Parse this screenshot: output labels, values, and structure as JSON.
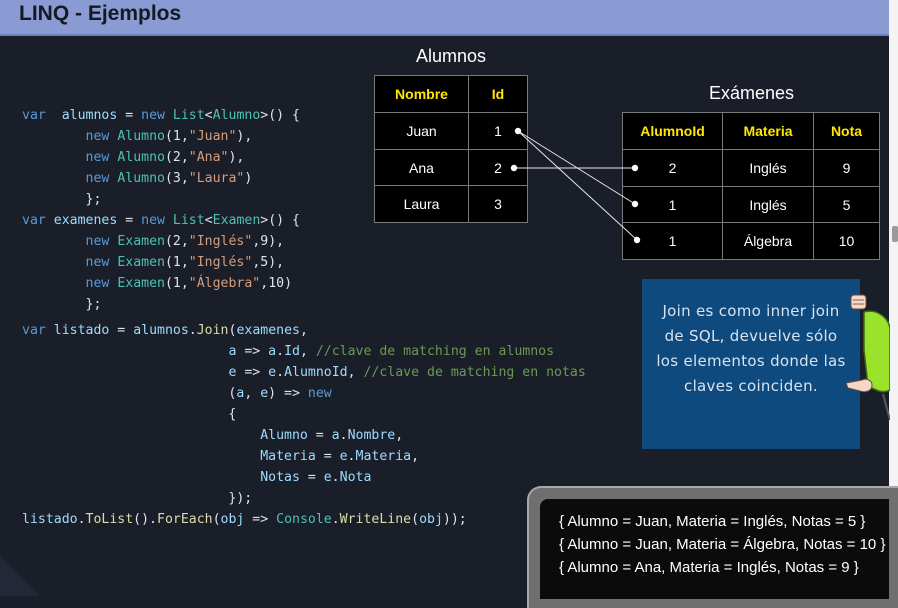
{
  "header": {
    "title": "LINQ - Ejemplos"
  },
  "alumnos_table": {
    "title": "Alumnos",
    "headers": [
      "Nombre",
      "Id"
    ],
    "rows": [
      [
        "Juan",
        "1"
      ],
      [
        "Ana",
        "2"
      ],
      [
        "Laura",
        "3"
      ]
    ]
  },
  "examenes_table": {
    "title": "Exámenes",
    "headers": [
      "AlumnoId",
      "Materia",
      "Nota"
    ],
    "rows": [
      [
        "2",
        "Inglés",
        "9"
      ],
      [
        "1",
        "Inglés",
        "5"
      ],
      [
        "1",
        "Álgebra",
        "10"
      ]
    ]
  },
  "note": {
    "text": "Join es como inner join de SQL, devuelve sólo los elementos donde las claves coinciden."
  },
  "console": {
    "lines": [
      "{ Alumno = Juan, Materia = Inglés, Notas = 5 }",
      "{ Alumno = Juan, Materia = Álgebra, Notas = 10 }",
      "{ Alumno = Ana, Materia = Inglés, Notas = 9 }"
    ]
  },
  "code": {
    "block1": [
      [
        [
          "kw",
          "var"
        ],
        [
          "",
          "  "
        ],
        [
          "vr",
          "alumnos"
        ],
        [
          "",
          " = "
        ],
        [
          "kw",
          "new"
        ],
        [
          "",
          " "
        ],
        [
          "ty",
          "List"
        ],
        [
          "",
          "<"
        ],
        [
          "ty",
          "Alumno"
        ],
        [
          "",
          ">() {"
        ]
      ],
      [
        [
          "",
          "        "
        ],
        [
          "kw",
          "new"
        ],
        [
          "",
          " "
        ],
        [
          "ty",
          "Alumno"
        ],
        [
          "",
          "(1,"
        ],
        [
          "st",
          "\"Juan\""
        ],
        [
          "",
          "),"
        ]
      ],
      [
        [
          "",
          "        "
        ],
        [
          "kw",
          "new"
        ],
        [
          "",
          " "
        ],
        [
          "ty",
          "Alumno"
        ],
        [
          "",
          "(2,"
        ],
        [
          "st",
          "\"Ana\""
        ],
        [
          "",
          "),"
        ]
      ],
      [
        [
          "",
          "        "
        ],
        [
          "kw",
          "new"
        ],
        [
          "",
          " "
        ],
        [
          "ty",
          "Alumno"
        ],
        [
          "",
          "(3,"
        ],
        [
          "st",
          "\"Laura\""
        ],
        [
          "",
          ")"
        ]
      ],
      [
        [
          "",
          "        };"
        ]
      ],
      [
        [
          "kw",
          "var"
        ],
        [
          "",
          " "
        ],
        [
          "vr",
          "examenes"
        ],
        [
          "",
          " = "
        ],
        [
          "kw",
          "new"
        ],
        [
          "",
          " "
        ],
        [
          "ty",
          "List"
        ],
        [
          "",
          "<"
        ],
        [
          "ty",
          "Examen"
        ],
        [
          "",
          ">() {"
        ]
      ],
      [
        [
          "",
          "        "
        ],
        [
          "kw",
          "new"
        ],
        [
          "",
          " "
        ],
        [
          "ty",
          "Examen"
        ],
        [
          "",
          "(2,"
        ],
        [
          "st",
          "\"Inglés\""
        ],
        [
          "",
          ",9),"
        ]
      ],
      [
        [
          "",
          "        "
        ],
        [
          "kw",
          "new"
        ],
        [
          "",
          " "
        ],
        [
          "ty",
          "Examen"
        ],
        [
          "",
          "(1,"
        ],
        [
          "st",
          "\"Inglés\""
        ],
        [
          "",
          ",5),"
        ]
      ],
      [
        [
          "",
          "        "
        ],
        [
          "kw",
          "new"
        ],
        [
          "",
          " "
        ],
        [
          "ty",
          "Examen"
        ],
        [
          "",
          "(1,"
        ],
        [
          "st",
          "\"Álgebra\""
        ],
        [
          "",
          ",10)"
        ]
      ],
      [
        [
          "",
          "        };"
        ]
      ]
    ],
    "block2": [
      [
        [
          "kw",
          "var"
        ],
        [
          "",
          " "
        ],
        [
          "vr",
          "listado"
        ],
        [
          "",
          " = "
        ],
        [
          "vr",
          "alumnos"
        ],
        [
          "",
          "."
        ],
        [
          "fn",
          "Join"
        ],
        [
          "",
          "("
        ],
        [
          "vr",
          "examenes"
        ],
        [
          "",
          ","
        ]
      ],
      [
        [
          "",
          "                          "
        ],
        [
          "vr",
          "a"
        ],
        [
          "",
          " => "
        ],
        [
          "vr",
          "a"
        ],
        [
          "",
          "."
        ],
        [
          "vr",
          "Id"
        ],
        [
          "",
          ", "
        ],
        [
          "cm",
          "//clave de matching en alumnos"
        ]
      ],
      [
        [
          "",
          "                          "
        ],
        [
          "vr",
          "e"
        ],
        [
          "",
          " => "
        ],
        [
          "vr",
          "e"
        ],
        [
          "",
          "."
        ],
        [
          "vr",
          "AlumnoId"
        ],
        [
          "",
          ", "
        ],
        [
          "cm",
          "//clave de matching en notas"
        ]
      ],
      [
        [
          "",
          "                          ("
        ],
        [
          "vr",
          "a"
        ],
        [
          "",
          ", "
        ],
        [
          "vr",
          "e"
        ],
        [
          "",
          ") => "
        ],
        [
          "kw",
          "new"
        ]
      ],
      [
        [
          "",
          "                          {"
        ]
      ],
      [
        [
          "",
          "                              "
        ],
        [
          "vr",
          "Alumno"
        ],
        [
          "",
          " = "
        ],
        [
          "vr",
          "a"
        ],
        [
          "",
          "."
        ],
        [
          "vr",
          "Nombre"
        ],
        [
          "",
          ","
        ]
      ],
      [
        [
          "",
          "                              "
        ],
        [
          "vr",
          "Materia"
        ],
        [
          "",
          " = "
        ],
        [
          "vr",
          "e"
        ],
        [
          "",
          "."
        ],
        [
          "vr",
          "Materia"
        ],
        [
          "",
          ","
        ]
      ],
      [
        [
          "",
          "                              "
        ],
        [
          "vr",
          "Notas"
        ],
        [
          "",
          " = "
        ],
        [
          "vr",
          "e"
        ],
        [
          "",
          "."
        ],
        [
          "vr",
          "Nota"
        ]
      ],
      [
        [
          "",
          "                          });"
        ]
      ],
      [
        [
          "vr",
          "listado"
        ],
        [
          "",
          "."
        ],
        [
          "fn",
          "ToList"
        ],
        [
          "",
          "()."
        ],
        [
          "fn",
          "ForEach"
        ],
        [
          "",
          "("
        ],
        [
          "vr",
          "obj"
        ],
        [
          "",
          " => "
        ],
        [
          "ty",
          "Console"
        ],
        [
          "",
          "."
        ],
        [
          "fn",
          "WriteLine"
        ],
        [
          "",
          "("
        ],
        [
          "vr",
          "obj"
        ],
        [
          "",
          "));"
        ]
      ]
    ]
  }
}
